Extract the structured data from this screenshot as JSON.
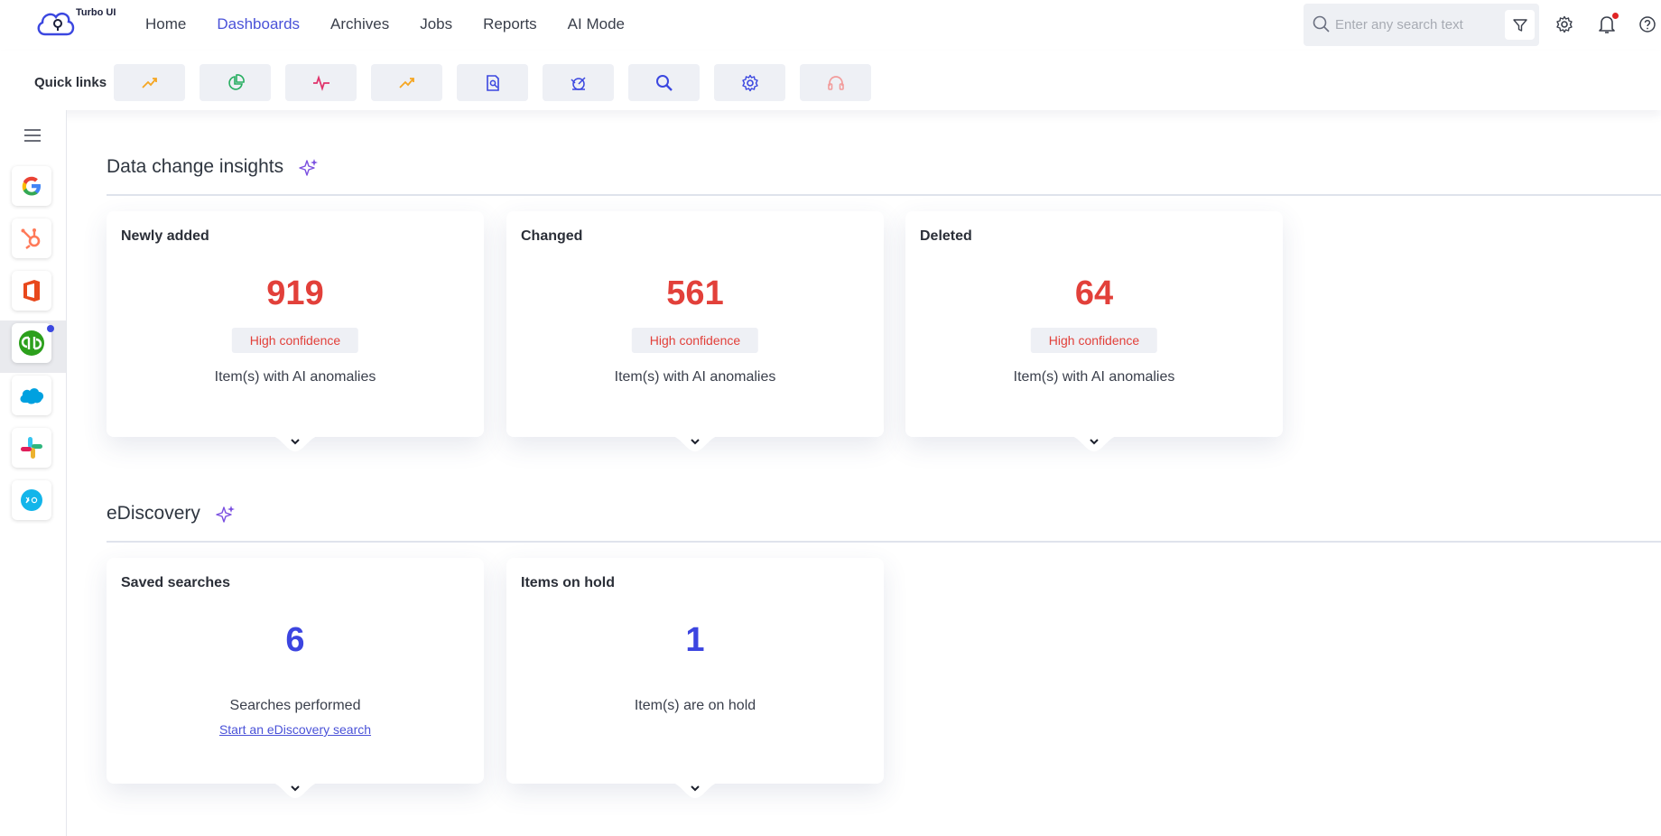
{
  "app": {
    "name": "Turbo UI"
  },
  "nav": {
    "items": [
      {
        "label": "Home",
        "active": false
      },
      {
        "label": "Dashboards",
        "active": true
      },
      {
        "label": "Archives",
        "active": false
      },
      {
        "label": "Jobs",
        "active": false
      },
      {
        "label": "Reports",
        "active": false
      },
      {
        "label": "AI Mode",
        "active": false
      }
    ]
  },
  "search": {
    "placeholder": "Enter any search text"
  },
  "quick_links": {
    "label": "Quick links",
    "items": [
      {
        "icon": "trend-up-icon",
        "color": "#f5a623"
      },
      {
        "icon": "pie-chart-icon",
        "color": "#27ae60"
      },
      {
        "icon": "pulse-icon",
        "color": "#e0336b"
      },
      {
        "icon": "trend-up-icon",
        "color": "#f5a623"
      },
      {
        "icon": "report-search-icon",
        "color": "#3b47e0"
      },
      {
        "icon": "radar-icon",
        "color": "#3b47e0"
      },
      {
        "icon": "search-icon",
        "color": "#3b47e0"
      },
      {
        "icon": "gear-icon",
        "color": "#3b47e0"
      },
      {
        "icon": "headset-icon",
        "color": "#f29b9b"
      }
    ]
  },
  "sidebar": {
    "apps": [
      {
        "name": "google-app-icon"
      },
      {
        "name": "hubspot-app-icon"
      },
      {
        "name": "office-app-icon"
      },
      {
        "name": "quickbooks-app-icon",
        "active": true
      },
      {
        "name": "salesforce-app-icon"
      },
      {
        "name": "slack-app-icon"
      },
      {
        "name": "xero-app-icon"
      }
    ]
  },
  "sections": {
    "insights": {
      "title": "Data change insights",
      "cards": [
        {
          "title": "Newly added",
          "value": "919",
          "badge": "High confidence",
          "desc": "Item(s) with AI anomalies"
        },
        {
          "title": "Changed",
          "value": "561",
          "badge": "High confidence",
          "desc": "Item(s) with AI anomalies"
        },
        {
          "title": "Deleted",
          "value": "64",
          "badge": "High confidence",
          "desc": "Item(s) with AI anomalies"
        }
      ]
    },
    "ediscovery": {
      "title": "eDiscovery",
      "cards": [
        {
          "title": "Saved searches",
          "value": "6",
          "desc": "Searches performed",
          "link": "Start an eDiscovery search"
        },
        {
          "title": "Items on hold",
          "value": "1",
          "desc": "Item(s) are on hold"
        }
      ]
    }
  },
  "colors": {
    "accent": "#4a52d8",
    "alert": "#e2403a",
    "value_blue": "#3c45e0"
  }
}
